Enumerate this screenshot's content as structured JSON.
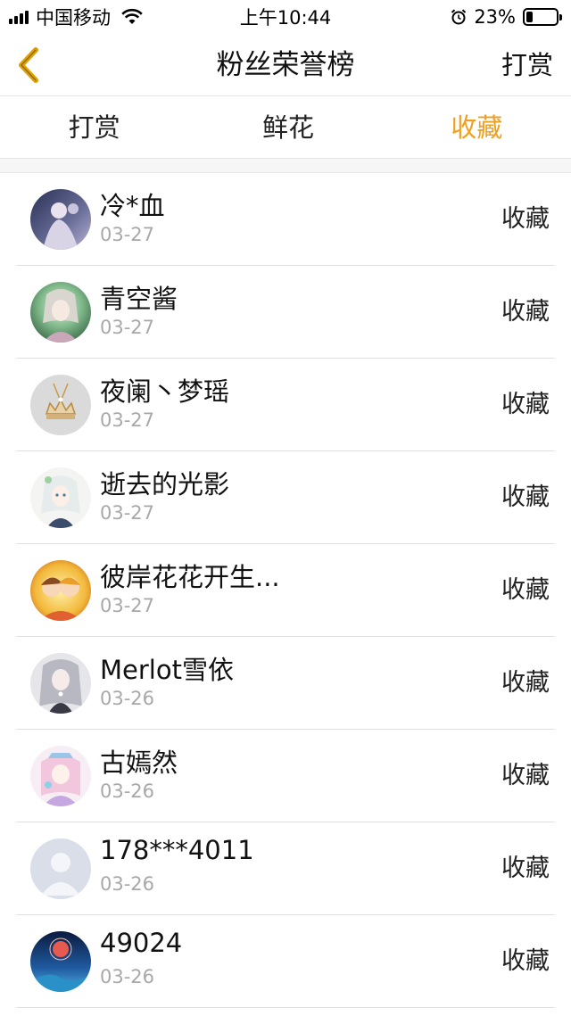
{
  "status_bar": {
    "carrier": "中国移动",
    "time": "上午10:44",
    "battery_percent": "23%",
    "battery_level": 0.23
  },
  "nav": {
    "title": "粉丝荣誉榜",
    "right_label": "打赏",
    "back_icon": "chevron-left-icon",
    "back_color": "#e0a000"
  },
  "tabs": [
    {
      "label": "打赏",
      "active": false
    },
    {
      "label": "鲜花",
      "active": false
    },
    {
      "label": "收藏",
      "active": true
    }
  ],
  "colors": {
    "accent": "#f0a020",
    "date": "#a8a8a8"
  },
  "list": [
    {
      "name": "冷*血",
      "date": "03-27",
      "action": "收藏"
    },
    {
      "name": "青空酱",
      "date": "03-27",
      "action": "收藏"
    },
    {
      "name": "夜阑丶梦瑶",
      "date": "03-27",
      "action": "收藏"
    },
    {
      "name": "逝去的光影",
      "date": "03-27",
      "action": "收藏"
    },
    {
      "name": "彼岸花花开生...",
      "date": "03-27",
      "action": "收藏"
    },
    {
      "name": "Merlot雪依",
      "date": "03-26",
      "action": "收藏"
    },
    {
      "name": "古嫣然",
      "date": "03-26",
      "action": "收藏"
    },
    {
      "name": "178***4011",
      "date": "03-26",
      "action": "收藏"
    },
    {
      "name": "49024",
      "date": "03-26",
      "action": "收藏"
    }
  ]
}
